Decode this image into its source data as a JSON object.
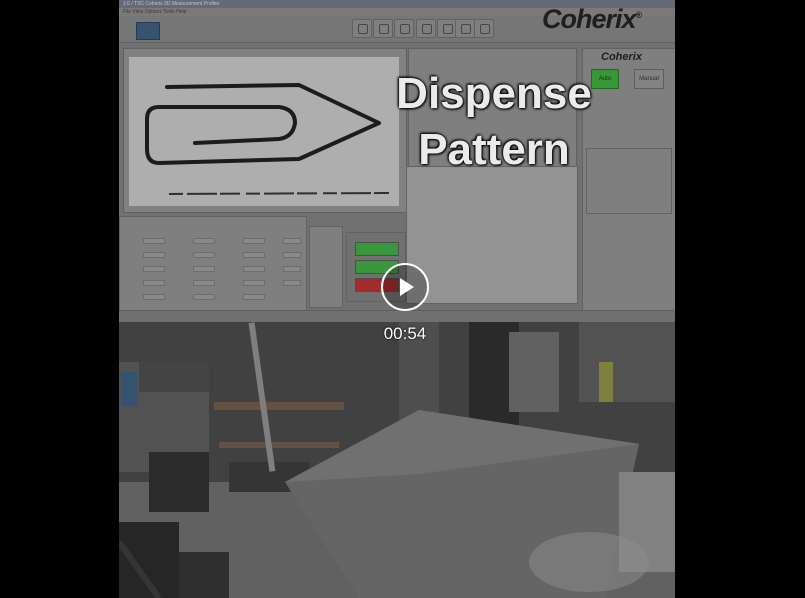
{
  "software": {
    "window_title": "1:0 / TSC Coherix 3D Measurement Profiler",
    "menu": "File  View  Options  Tools  Help",
    "logo": "Coherix",
    "panel_logo": "Coherix",
    "auto_label": "Auto",
    "manual_label": "Manual"
  },
  "overlay": {
    "line1": "Dispense",
    "line2": "Pattern"
  },
  "player": {
    "time": "00:54"
  }
}
